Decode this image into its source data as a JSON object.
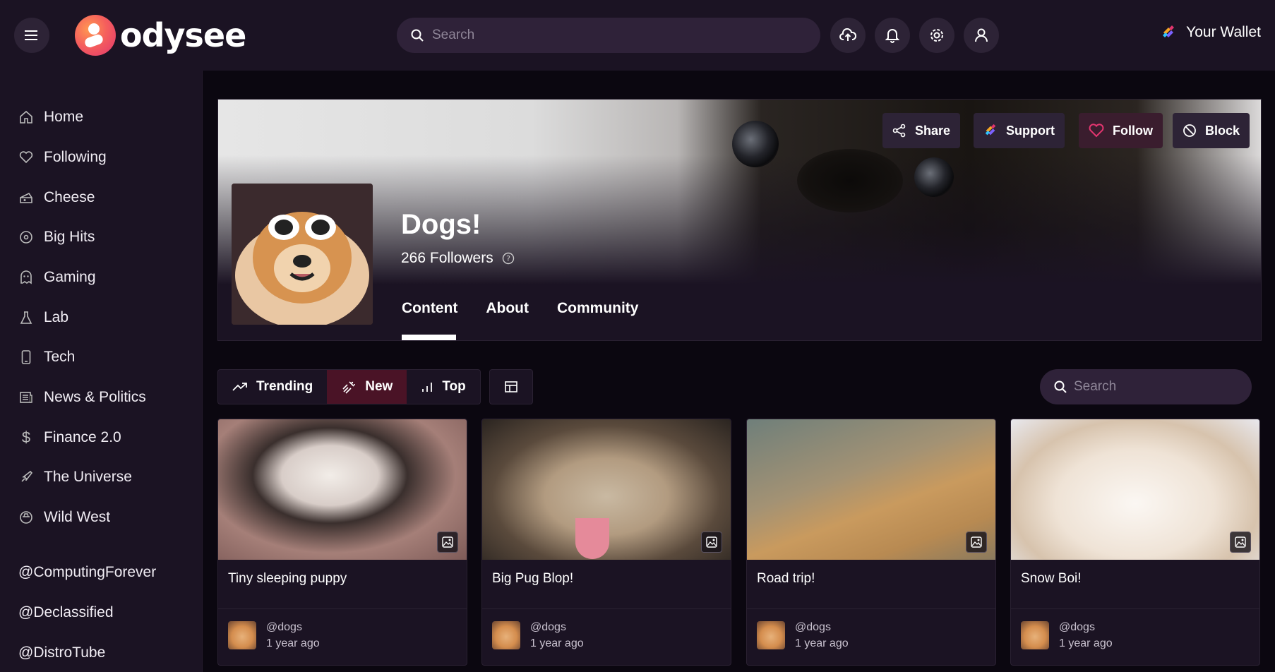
{
  "header": {
    "logo_text": "odysee",
    "search_placeholder": "Search",
    "wallet_label": "Your Wallet",
    "icons": [
      "menu-icon",
      "upload-icon",
      "bell-icon",
      "gear-icon",
      "user-icon"
    ]
  },
  "sidebar": {
    "items": [
      {
        "label": "Home",
        "icon": "home-icon"
      },
      {
        "label": "Following",
        "icon": "heart-icon"
      },
      {
        "label": "Cheese",
        "icon": "cheese-icon"
      },
      {
        "label": "Big Hits",
        "icon": "disc-icon"
      },
      {
        "label": "Gaming",
        "icon": "ghost-icon"
      },
      {
        "label": "Lab",
        "icon": "flask-icon"
      },
      {
        "label": "Tech",
        "icon": "phone-icon"
      },
      {
        "label": "News & Politics",
        "icon": "newspaper-icon"
      },
      {
        "label": "Finance 2.0",
        "icon": "dollar-icon"
      },
      {
        "label": "The Universe",
        "icon": "rocket-icon"
      },
      {
        "label": "Wild West",
        "icon": "cowboy-icon"
      }
    ],
    "channels": [
      "@ComputingForever",
      "@Declassified",
      "@DistroTube"
    ]
  },
  "channel": {
    "title": "Dogs!",
    "followers": "266 Followers",
    "actions": {
      "share": "Share",
      "support": "Support",
      "follow": "Follow",
      "block": "Block"
    },
    "tabs": [
      "Content",
      "About",
      "Community"
    ],
    "active_tab": "Content"
  },
  "filters": {
    "trending": "Trending",
    "new": "New",
    "top": "Top",
    "active": "New",
    "search_placeholder": "Search"
  },
  "cards": [
    {
      "title": "Tiny sleeping puppy",
      "channel": "@dogs",
      "time": "1 year ago"
    },
    {
      "title": "Big Pug Blop!",
      "channel": "@dogs",
      "time": "1 year ago"
    },
    {
      "title": "Road trip!",
      "channel": "@dogs",
      "time": "1 year ago"
    },
    {
      "title": "Snow Boi!",
      "channel": "@dogs",
      "time": "1 year ago"
    }
  ],
  "colors": {
    "background": "#0b0710",
    "surface": "#1b1323",
    "accent": "#e2356f",
    "active_filter": "#4a1326"
  }
}
